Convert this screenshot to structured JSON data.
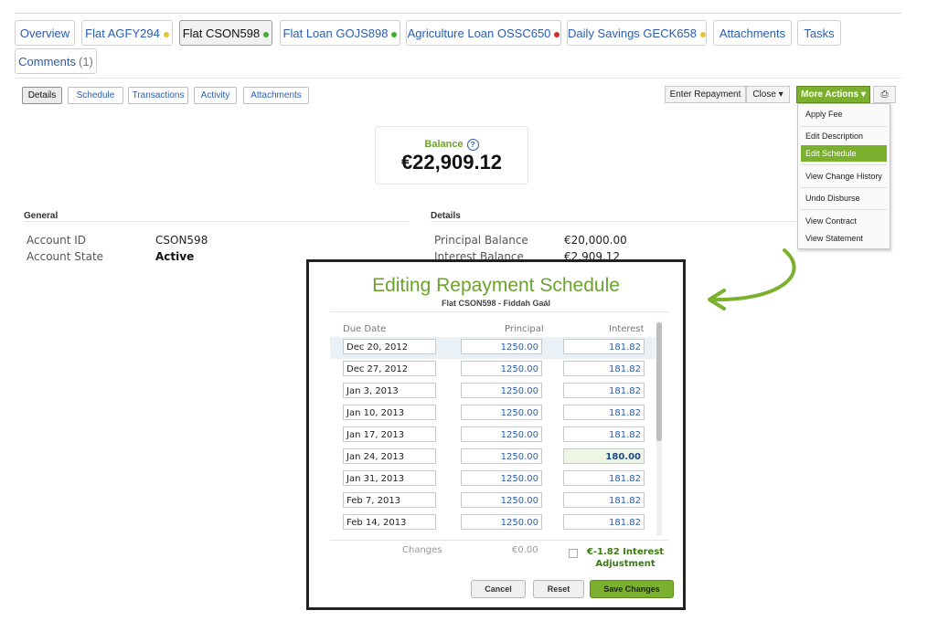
{
  "tabs": [
    {
      "label": "Overview"
    },
    {
      "label": "Flat AGFY294",
      "dot": "#e5c33a"
    },
    {
      "label": "Flat CSON598",
      "dot": "#3fae2a"
    },
    {
      "label": "Flat Loan GOJS898",
      "dot": "#3fae2a"
    },
    {
      "label": "Agriculture Loan OSSC650",
      "dot": "#d82c2c"
    },
    {
      "label": "Daily Savings GECK658",
      "dot": "#e5c33a"
    },
    {
      "label": "Attachments"
    },
    {
      "label": "Tasks"
    },
    {
      "label": "Comments",
      "count": "(1)"
    }
  ],
  "subtabs": [
    "Details",
    "Schedule",
    "Transactions",
    "Activity",
    "Attachments"
  ],
  "actions": {
    "enter_repayment": "Enter Repayment",
    "close": "Close ▾",
    "more_actions": "More Actions ▾",
    "print": "⎙"
  },
  "balance": {
    "label": "Balance",
    "help": "?",
    "value": "€22,909.12"
  },
  "general": {
    "heading": "General",
    "rows": [
      {
        "label": "Account ID",
        "value": "CSON598"
      },
      {
        "label": "Account State",
        "value": "Active"
      }
    ]
  },
  "details": {
    "heading": "Details",
    "rows": [
      {
        "label": "Principal Balance",
        "value": "€20,000.00"
      },
      {
        "label": "Interest Balance",
        "value": "€2,909.12"
      }
    ]
  },
  "menu": [
    "Apply Fee",
    "Edit Description",
    "Edit Schedule",
    "View Change History",
    "Undo Disburse",
    "View Contract",
    "View Statement"
  ],
  "modal": {
    "title": "Editing Repayment Schedule",
    "subtitle": "Flat CSON598 - Fiddah Gaál",
    "columns": {
      "due_date": "Due Date",
      "principal": "Principal",
      "interest": "Interest"
    },
    "rows": [
      {
        "date": "Dec 20, 2012",
        "principal": "1250.00",
        "interest": "181.82"
      },
      {
        "date": "Dec 27, 2012",
        "principal": "1250.00",
        "interest": "181.82"
      },
      {
        "date": "Jan 3, 2013",
        "principal": "1250.00",
        "interest": "181.82"
      },
      {
        "date": "Jan 10, 2013",
        "principal": "1250.00",
        "interest": "181.82"
      },
      {
        "date": "Jan 17, 2013",
        "principal": "1250.00",
        "interest": "181.82"
      },
      {
        "date": "Jan 24, 2013",
        "principal": "1250.00",
        "interest": "180.00"
      },
      {
        "date": "Jan 31, 2013",
        "principal": "1250.00",
        "interest": "181.82"
      },
      {
        "date": "Feb 7, 2013",
        "principal": "1250.00",
        "interest": "181.82"
      },
      {
        "date": "Feb 14, 2013",
        "principal": "1250.00",
        "interest": "181.82"
      }
    ],
    "changes_label": "Changes",
    "changes_principal": "€0.00",
    "interest_adjustment": "€-1.82 Interest Adjustment",
    "buttons": {
      "cancel": "Cancel",
      "reset": "Reset",
      "save": "Save Changes"
    }
  },
  "colors": {
    "accent_green": "#7bb02e",
    "link_blue": "#2a5db0"
  }
}
